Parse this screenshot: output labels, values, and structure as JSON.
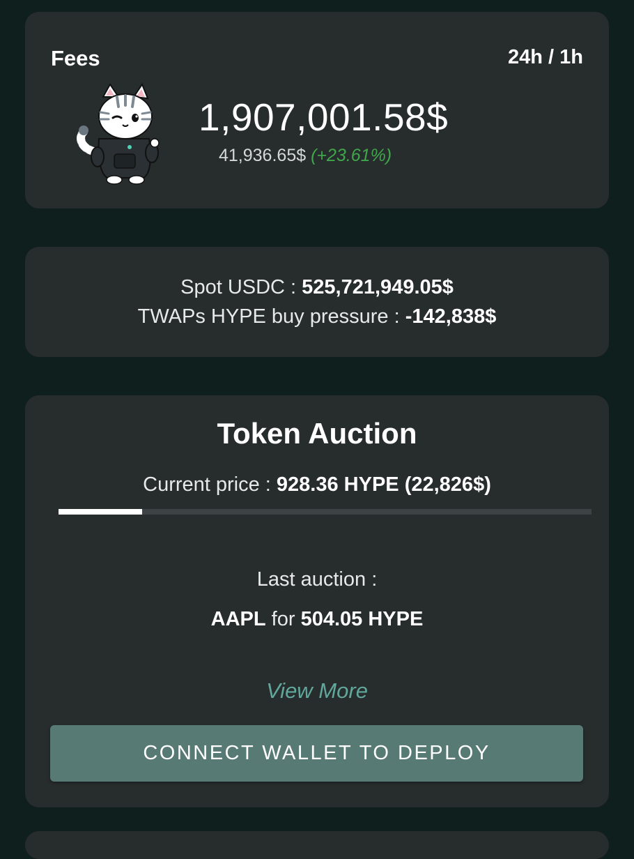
{
  "fees": {
    "label": "Fees",
    "period_toggle": "24h / 1h",
    "total": "1,907,001.58$",
    "hourly": "41,936.65$",
    "change": "(+23.61%)",
    "change_color": "#3fa84a",
    "mascot_icon": "cat-in-hoodie-icon"
  },
  "spot": {
    "usdc_label": "Spot USDC : ",
    "usdc_value": "525,721,949.05$",
    "twap_label": "TWAPs HYPE buy pressure : ",
    "twap_value": "-142,838$"
  },
  "auction": {
    "title": "Token Auction",
    "current_price_label": "Current price : ",
    "current_price_value": "928.36 HYPE (22,826$)",
    "progress_fraction": 0.157,
    "last_label": "Last auction :",
    "last_token": "AAPL",
    "last_for": " for ",
    "last_amount": "504.05 HYPE",
    "view_more": "View More",
    "connect_button": "CONNECT WALLET TO DEPLOY"
  },
  "colors": {
    "background": "#0f1f1d",
    "card": "#272c2d",
    "accent": "#62a79c",
    "button": "#587a74"
  }
}
